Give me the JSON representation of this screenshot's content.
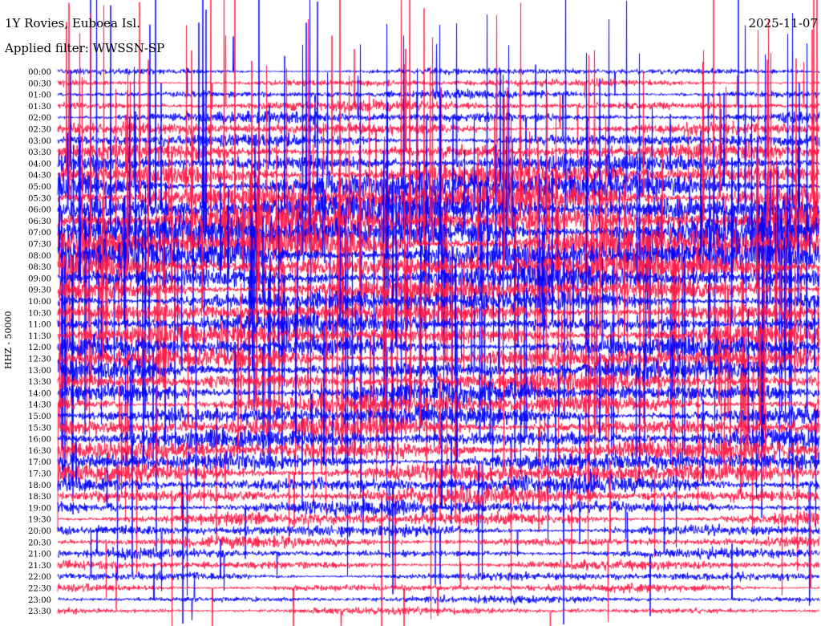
{
  "header": {
    "station": "1Y Rovies, Euboea Isl.",
    "filter": "Applied filter: WWSSN-SP",
    "date": "2025-11-07"
  },
  "chart_data": {
    "type": "helicorder",
    "title": "1Y Rovies, Euboea Isl.",
    "subtitle": "Applied filter: WWSSN-SP",
    "date": "2025-11-07",
    "ylabel": "HHZ - 50000",
    "row_labels": [
      "00:00",
      "00:30",
      "01:00",
      "01:30",
      "02:00",
      "02:30",
      "03:00",
      "03:30",
      "04:00",
      "04:30",
      "05:00",
      "05:30",
      "06:00",
      "06:30",
      "07:00",
      "07:30",
      "08:00",
      "08:30",
      "09:00",
      "09:30",
      "10:00",
      "10:30",
      "11:00",
      "11:30",
      "12:00",
      "12:30",
      "13:00",
      "13:30",
      "14:00",
      "14:30",
      "15:00",
      "15:30",
      "16:00",
      "16:30",
      "17:00",
      "17:30",
      "18:00",
      "18:30",
      "19:00",
      "19:30",
      "20:00",
      "20:30",
      "21:00",
      "21:30",
      "22:00",
      "22:30",
      "23:00",
      "23:30"
    ],
    "row_interval_minutes": 30,
    "colors": [
      "#0000ff",
      "#ff1744"
    ],
    "relative_amplitude": [
      0.6,
      0.7,
      0.8,
      1.0,
      1.1,
      1.2,
      1.3,
      1.5,
      1.8,
      2.2,
      2.6,
      3.0,
      3.2,
      3.3,
      3.3,
      3.2,
      3.0,
      2.7,
      2.4,
      2.2,
      2.1,
      2.0,
      2.0,
      2.0,
      2.1,
      2.0,
      2.0,
      2.0,
      2.0,
      1.9,
      1.9,
      1.9,
      1.9,
      1.9,
      1.9,
      1.9,
      1.8,
      1.7,
      1.5,
      1.3,
      1.1,
      1.0,
      0.9,
      0.9,
      0.8,
      0.8,
      0.7,
      0.7
    ]
  }
}
